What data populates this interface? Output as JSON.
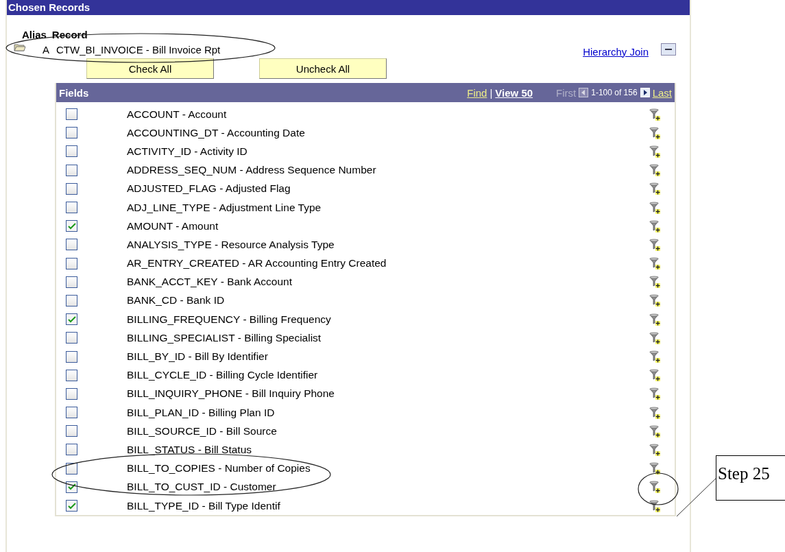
{
  "section": {
    "title": "Chosen Records"
  },
  "record_header": {
    "alias_label": "Alias",
    "record_label": "Record"
  },
  "record": {
    "alias": "A",
    "name": "CTW_BI_INVOICE - Bill Invoice Rpt",
    "link": "Hierarchy Join"
  },
  "buttons": [
    "Check All",
    "Uncheck All"
  ],
  "fields": {
    "title": "Fields",
    "find": "Find",
    "separator": "|",
    "view": "View 50",
    "first": "First",
    "range": "1-100 of 156",
    "last": "Last",
    "rows": [
      {
        "label": "ACCOUNT - Account",
        "checked": false
      },
      {
        "label": "ACCOUNTING_DT - Accounting Date",
        "checked": false
      },
      {
        "label": "ACTIVITY_ID - Activity ID",
        "checked": false
      },
      {
        "label": "ADDRESS_SEQ_NUM - Address Sequence Number",
        "checked": false
      },
      {
        "label": "ADJUSTED_FLAG - Adjusted Flag",
        "checked": false
      },
      {
        "label": "ADJ_LINE_TYPE - Adjustment Line Type",
        "checked": false
      },
      {
        "label": "AMOUNT - Amount",
        "checked": true
      },
      {
        "label": "ANALYSIS_TYPE - Resource Analysis Type",
        "checked": false
      },
      {
        "label": "AR_ENTRY_CREATED - AR Accounting Entry Created",
        "checked": false
      },
      {
        "label": "BANK_ACCT_KEY - Bank Account",
        "checked": false
      },
      {
        "label": "BANK_CD - Bank ID",
        "checked": false
      },
      {
        "label": "BILLING_FREQUENCY - Billing Frequency",
        "checked": true
      },
      {
        "label": "BILLING_SPECIALIST - Billing Specialist",
        "checked": false
      },
      {
        "label": "BILL_BY_ID - Bill By Identifier",
        "checked": false
      },
      {
        "label": "BILL_CYCLE_ID - Billing Cycle Identifier",
        "checked": false
      },
      {
        "label": "BILL_INQUIRY_PHONE - Bill Inquiry Phone",
        "checked": false
      },
      {
        "label": "BILL_PLAN_ID - Billing Plan ID",
        "checked": false
      },
      {
        "label": "BILL_SOURCE_ID - Bill Source",
        "checked": false
      },
      {
        "label": "BILL_STATUS - Bill Status",
        "checked": false
      },
      {
        "label": "BILL_TO_COPIES - Number of Copies",
        "checked": false
      },
      {
        "label": "BILL_TO_CUST_ID - Customer",
        "checked": true
      },
      {
        "label": "BILL_TYPE_ID - Bill Type Identif",
        "checked": true
      }
    ]
  },
  "callout": {
    "text": "Step 25"
  }
}
